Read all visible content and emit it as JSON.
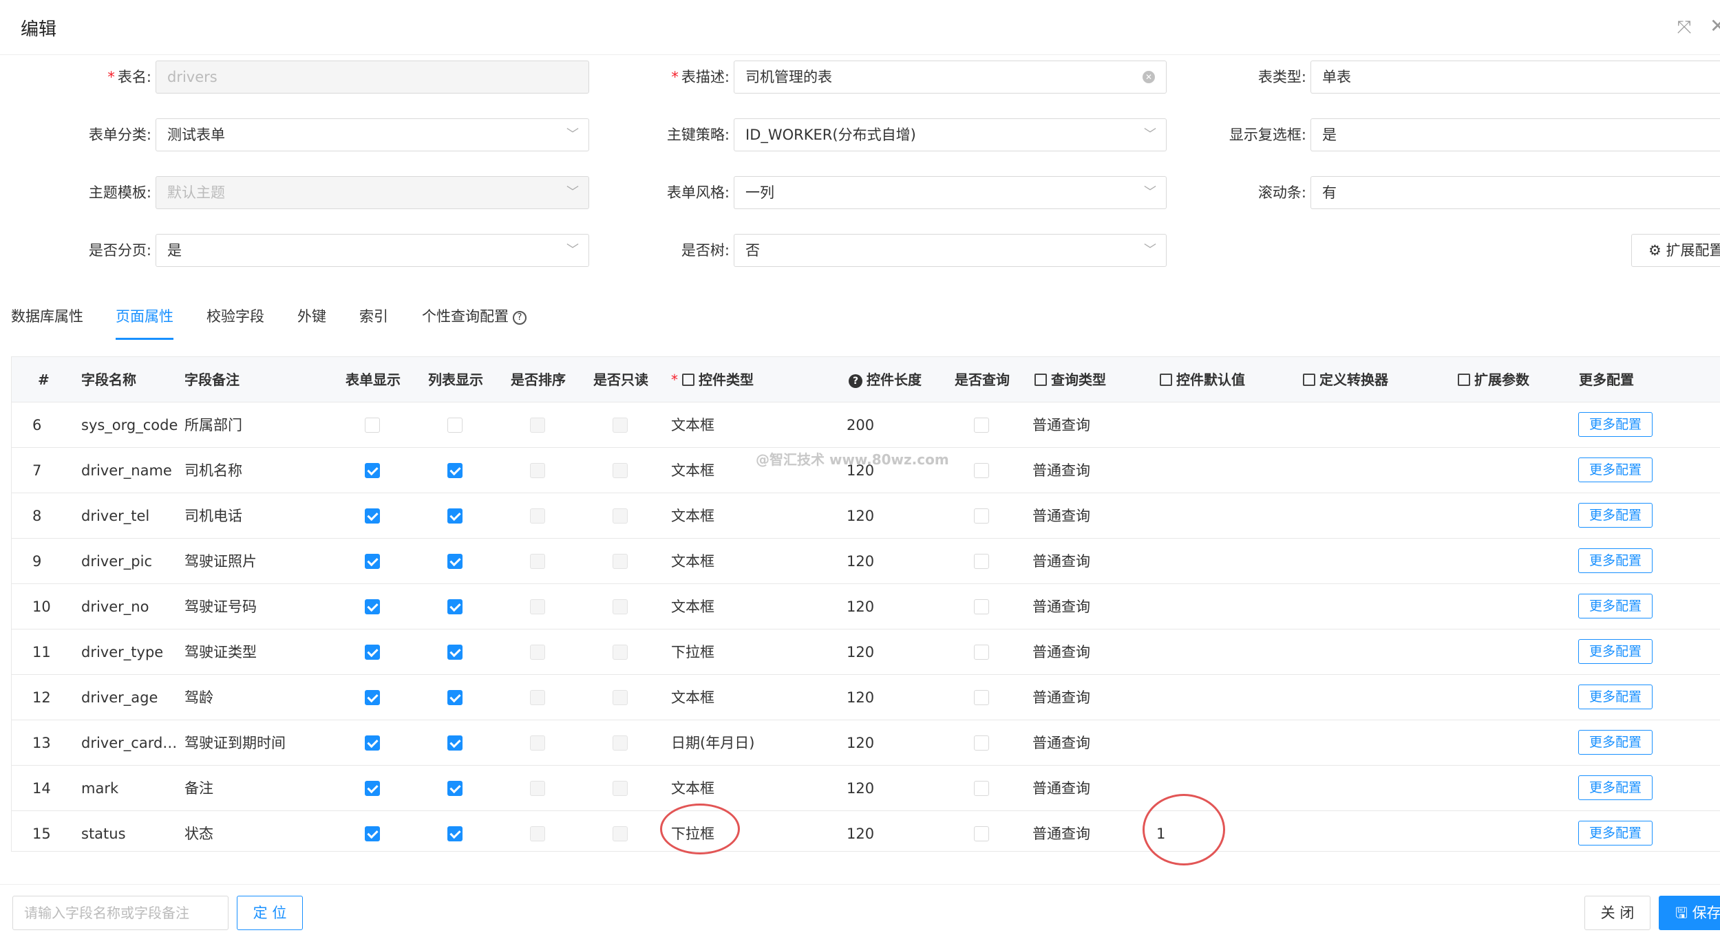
{
  "dialog": {
    "title": "编辑"
  },
  "form": {
    "table_name": {
      "label": "表名",
      "value": "drivers"
    },
    "table_desc": {
      "label": "表描述",
      "value": "司机管理的表"
    },
    "table_type": {
      "label": "表类型",
      "value": "单表"
    },
    "form_category": {
      "label": "表单分类",
      "value": "测试表单"
    },
    "pk_strategy": {
      "label": "主键策略",
      "value": "ID_WORKER(分布式自增)"
    },
    "show_checkbox": {
      "label": "显示复选框",
      "value": "是"
    },
    "theme_template": {
      "label": "主题模板",
      "value": "默认主题"
    },
    "form_style": {
      "label": "表单风格",
      "value": "一列"
    },
    "scrollbar": {
      "label": "滚动条",
      "value": "有"
    },
    "paging": {
      "label": "是否分页",
      "value": "是"
    },
    "is_tree": {
      "label": "是否树",
      "value": "否"
    },
    "extend_config_label": "扩展配置"
  },
  "tabs": [
    "数据库属性",
    "页面属性",
    "校验字段",
    "外键",
    "索引",
    "个性查询配置"
  ],
  "table": {
    "headers": {
      "index": "#",
      "field_name": "字段名称",
      "field_comment": "字段备注",
      "form_show": "表单显示",
      "list_show": "列表显示",
      "sortable": "是否排序",
      "readonly": "是否只读",
      "control_type": "控件类型",
      "control_length": "控件长度",
      "is_query": "是否查询",
      "query_type": "查询类型",
      "default_value": "控件默认值",
      "converter": "定义转换器",
      "ext_params": "扩展参数",
      "more_config": "更多配置"
    },
    "rows": [
      {
        "index": "6",
        "name": "sys_org_code",
        "comment": "所属部门",
        "form_show": false,
        "list_show": false,
        "control": "文本框",
        "length": "200",
        "query": "普通查询",
        "default": "",
        "more": "更多配置"
      },
      {
        "index": "7",
        "name": "driver_name",
        "comment": "司机名称",
        "form_show": true,
        "list_show": true,
        "control": "文本框",
        "length": "120",
        "query": "普通查询",
        "default": "",
        "more": "更多配置"
      },
      {
        "index": "8",
        "name": "driver_tel",
        "comment": "司机电话",
        "form_show": true,
        "list_show": true,
        "control": "文本框",
        "length": "120",
        "query": "普通查询",
        "default": "",
        "more": "更多配置"
      },
      {
        "index": "9",
        "name": "driver_pic",
        "comment": "驾驶证照片",
        "form_show": true,
        "list_show": true,
        "control": "文本框",
        "length": "120",
        "query": "普通查询",
        "default": "",
        "more": "更多配置"
      },
      {
        "index": "10",
        "name": "driver_no",
        "comment": "驾驶证号码",
        "form_show": true,
        "list_show": true,
        "control": "文本框",
        "length": "120",
        "query": "普通查询",
        "default": "",
        "more": "更多配置"
      },
      {
        "index": "11",
        "name": "driver_type",
        "comment": "驾驶证类型",
        "form_show": true,
        "list_show": true,
        "control": "下拉框",
        "length": "120",
        "query": "普通查询",
        "default": "",
        "more": "更多配置"
      },
      {
        "index": "12",
        "name": "driver_age",
        "comment": "驾龄",
        "form_show": true,
        "list_show": true,
        "control": "文本框",
        "length": "120",
        "query": "普通查询",
        "default": "",
        "more": "更多配置"
      },
      {
        "index": "13",
        "name": "driver_card_...",
        "comment": "驾驶证到期时间",
        "form_show": true,
        "list_show": true,
        "control": "日期(年月日)",
        "length": "120",
        "query": "普通查询",
        "default": "",
        "more": "更多配置"
      },
      {
        "index": "14",
        "name": "mark",
        "comment": "备注",
        "form_show": true,
        "list_show": true,
        "control": "文本框",
        "length": "120",
        "query": "普通查询",
        "default": "",
        "more": "更多配置"
      },
      {
        "index": "15",
        "name": "status",
        "comment": "状态",
        "form_show": true,
        "list_show": true,
        "control": "下拉框",
        "length": "120",
        "query": "普通查询",
        "default": "1",
        "more": "更多配置"
      }
    ]
  },
  "watermark": "@智汇技术 www.80wz.com",
  "footer": {
    "search_placeholder": "请输入字段名称或字段备注",
    "locate_label": "定 位",
    "close_label": "关 闭",
    "save_label": "保存"
  },
  "colors": {
    "primary": "#1890ff",
    "required": "#f5222d",
    "annotation": "#e25555"
  }
}
